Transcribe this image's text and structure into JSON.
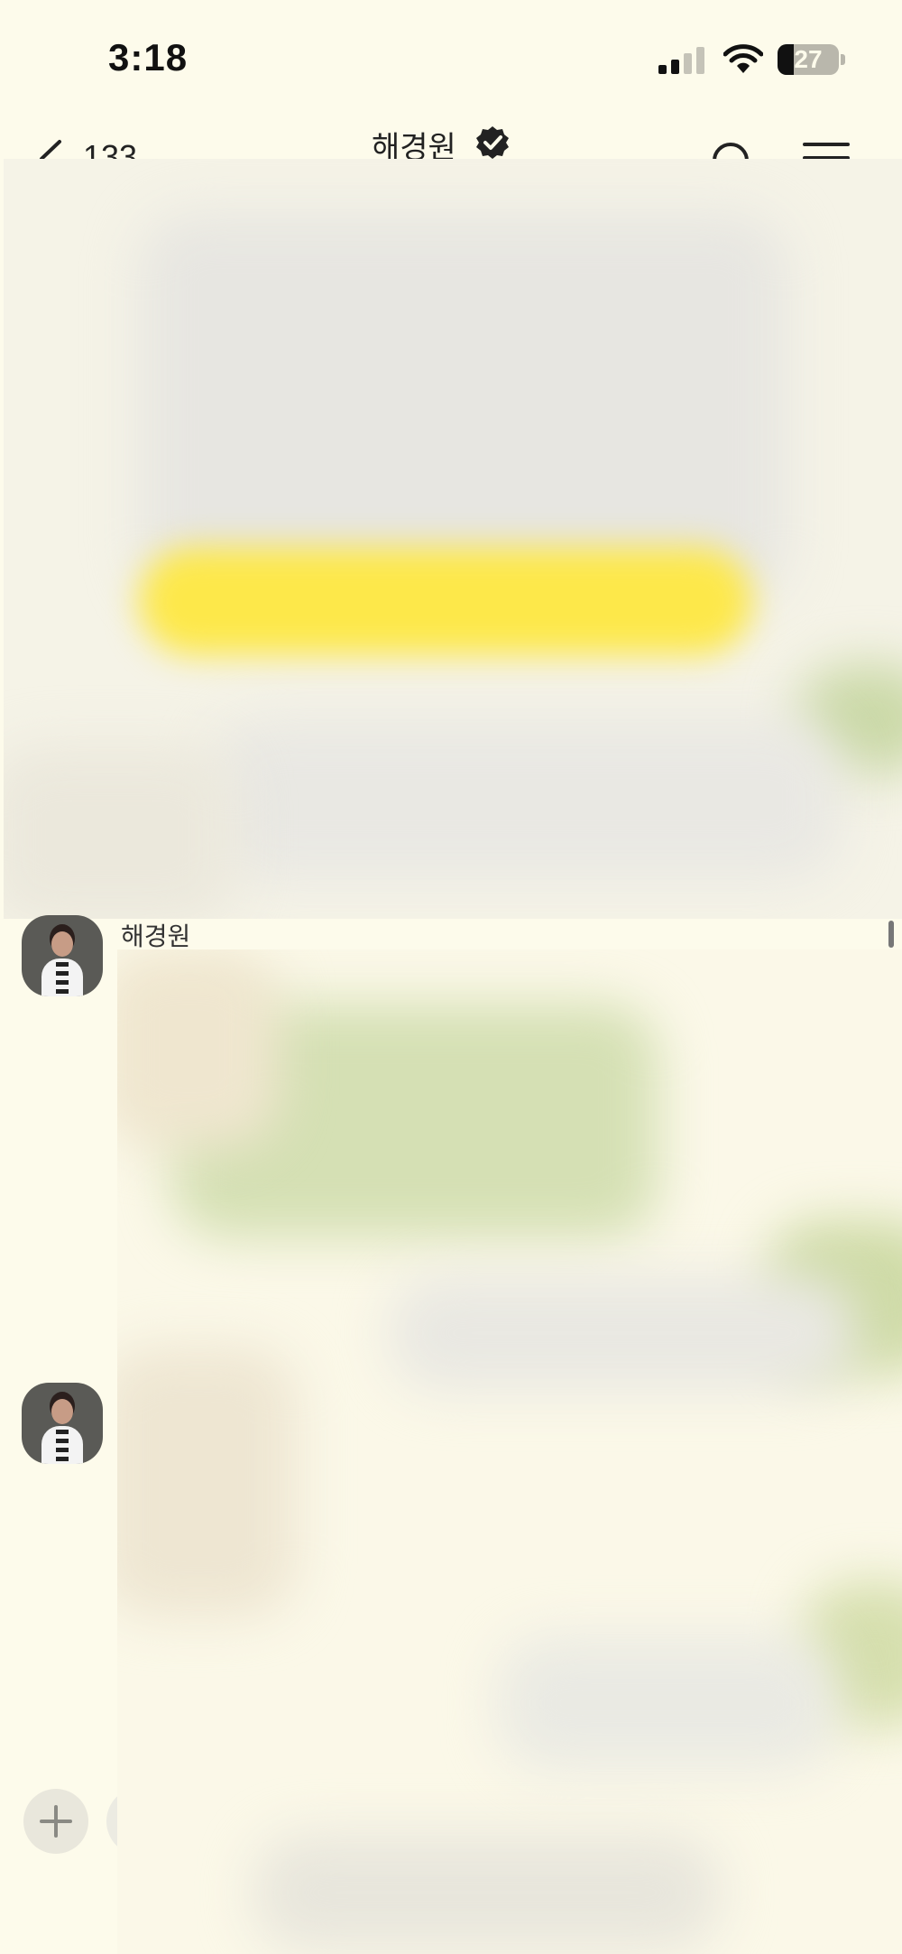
{
  "status_bar": {
    "time": "3:18",
    "battery_level": "27"
  },
  "header": {
    "unread_count": "133",
    "title": "해경원"
  },
  "messages": {
    "sender_name": "해경원"
  },
  "colors": {
    "background": "#fdfbeb",
    "accent_yellow": "#fde84a",
    "blur_green": "#cbd9a8"
  },
  "icons": {
    "back": "chevron-left-icon",
    "verified": "verified-badge-icon",
    "search": "search-icon",
    "menu": "hamburger-menu-icon",
    "add": "plus-icon"
  }
}
